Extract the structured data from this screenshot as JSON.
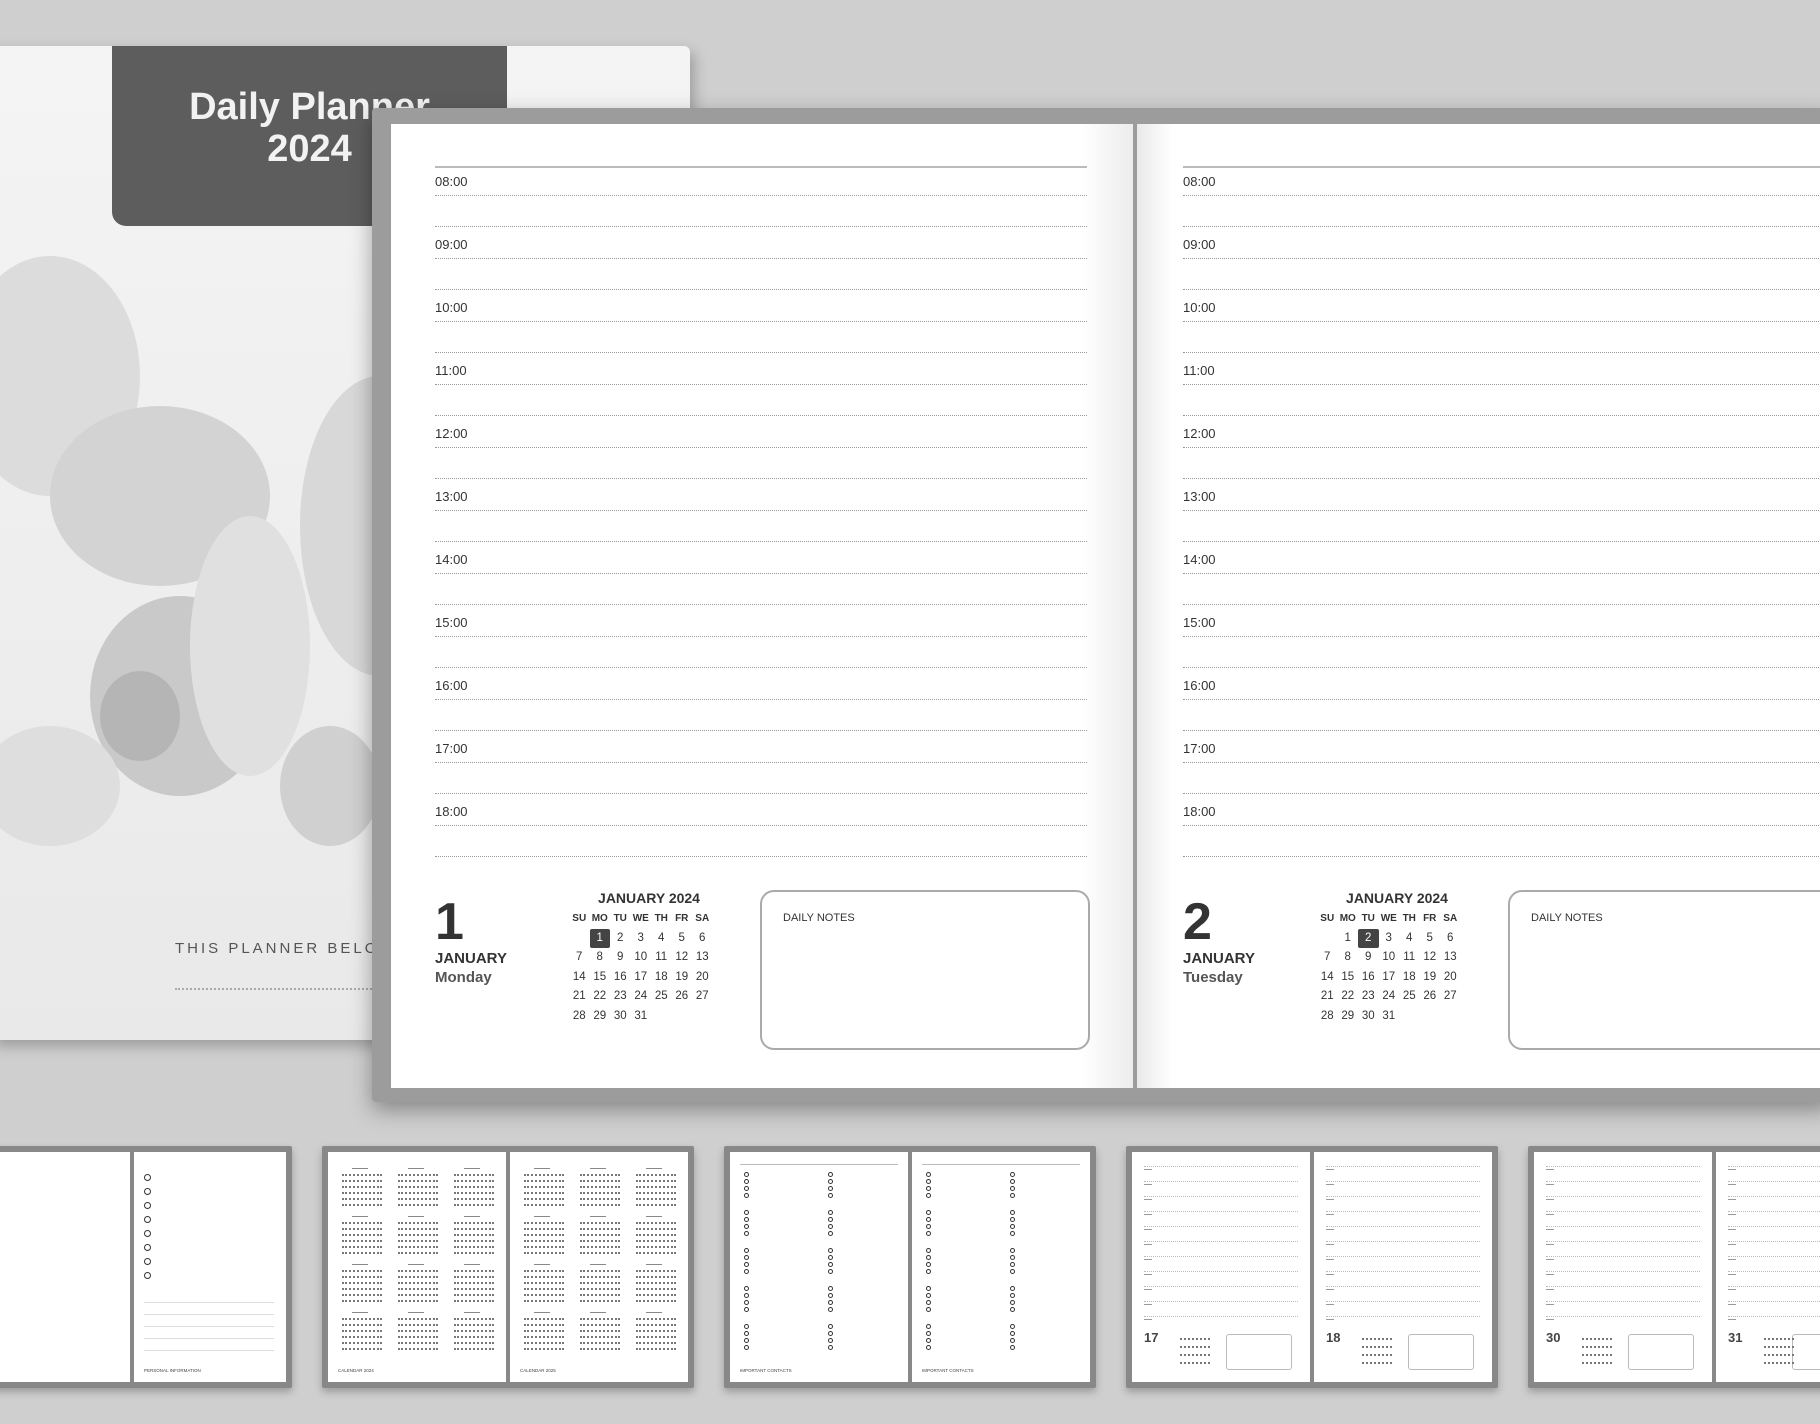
{
  "cover": {
    "title": "Daily Planner\n2024",
    "belongs_text": "THIS PLANNER BELO"
  },
  "times": [
    "08:00",
    "09:00",
    "10:00",
    "11:00",
    "12:00",
    "13:00",
    "14:00",
    "15:00",
    "16:00",
    "17:00",
    "18:00"
  ],
  "pages": [
    {
      "day_number": "1",
      "month": "JANUARY",
      "weekday": "Monday",
      "calendar_title": "JANUARY 2024",
      "weekday_headers": [
        "SU",
        "MO",
        "TU",
        "WE",
        "TH",
        "FR",
        "SA"
      ],
      "start_offset": 1,
      "days_in_month": 31,
      "selected_day": 1,
      "notes_label": "DAILY NOTES"
    },
    {
      "day_number": "2",
      "month": "JANUARY",
      "weekday": "Tuesday",
      "calendar_title": "JANUARY 2024",
      "weekday_headers": [
        "SU",
        "MO",
        "TU",
        "WE",
        "TH",
        "FR",
        "SA"
      ],
      "start_offset": 1,
      "days_in_month": 31,
      "selected_day": 2,
      "notes_label": "DAILY NOTES"
    }
  ],
  "thumbnails": [
    {
      "label": "PERSONAL INFORMATION"
    },
    {
      "label_left": "CALENDAR 2024",
      "label_right": "CALENDAR 2025"
    },
    {
      "label_left": "IMPORTANT CONTACTS",
      "label_right": "IMPORTANT CONTACTS"
    },
    {
      "left_day": "17",
      "right_day": "18"
    },
    {
      "left_day": "30",
      "right_day": "31"
    }
  ],
  "colors": {
    "background": "#cfcfcf",
    "cover_band": "#5d5d5d",
    "selected_day": "#444444",
    "page": "#ffffff"
  }
}
